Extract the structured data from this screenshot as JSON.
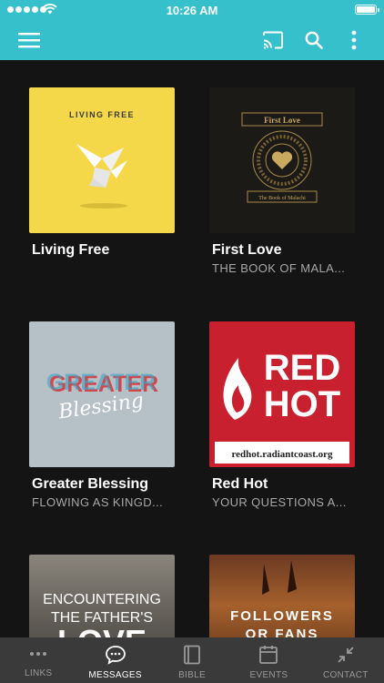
{
  "status_bar": {
    "time": "10:26 AM"
  },
  "messages": [
    {
      "title": "Living Free",
      "subtitle": "",
      "art_text": "LIVING FREE"
    },
    {
      "title": "First Love",
      "subtitle": "THE BOOK OF MALA...",
      "art_text": "First Love",
      "art_subtext": "The Book of Malachi"
    },
    {
      "title": "Greater Blessing",
      "subtitle": "FLOWING AS KINGD...",
      "art_text": "GREATER",
      "art_script": "Blessing"
    },
    {
      "title": "Red Hot",
      "subtitle": "YOUR QUESTIONS A...",
      "art_text_line1": "RED",
      "art_text_line2": "HOT",
      "art_url": "redhot.radiantcoast.org"
    },
    {
      "title": "",
      "subtitle": "",
      "art_text_line1": "ENCOUNTERING",
      "art_text_line2": "THE FATHER'S",
      "art_text_line3": "LOVE"
    },
    {
      "title": "",
      "subtitle": "",
      "art_text_line1": "FOLLOWERS",
      "art_text_line2": "OR FANS"
    }
  ],
  "tabs": [
    {
      "label": "LINKS",
      "icon": "dots-icon",
      "active": false
    },
    {
      "label": "MESSAGES",
      "icon": "chat-bubble-icon",
      "active": true
    },
    {
      "label": "BIBLE",
      "icon": "book-icon",
      "active": false
    },
    {
      "label": "EVENTS",
      "icon": "calendar-icon",
      "active": false
    },
    {
      "label": "CONTACT",
      "icon": "collapse-arrows-icon",
      "active": false
    }
  ],
  "colors": {
    "accent": "#36c0cc",
    "background": "#141414",
    "tab_bar": "#3a3a3a",
    "red_hot": "#c8202f",
    "living_free": "#f5d84a"
  }
}
